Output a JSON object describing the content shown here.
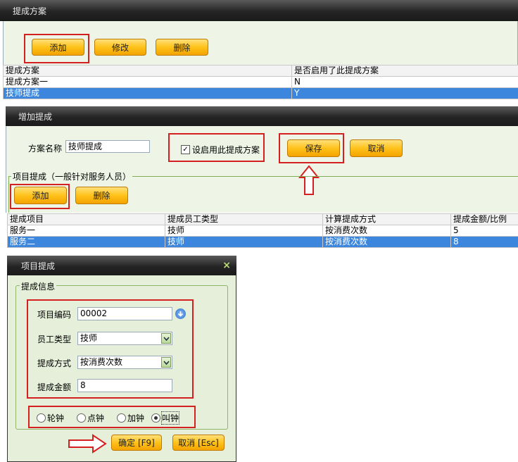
{
  "scheme_panel": {
    "title": "提成方案",
    "buttons": {
      "add": "添加",
      "edit": "修改",
      "delete": "删除"
    },
    "table": {
      "headers": [
        "提成方案",
        "是否启用了此提成方案"
      ],
      "rows": [
        {
          "name": "提成方案一",
          "enabled": "N"
        },
        {
          "name": "技师提成",
          "enabled": "Y"
        }
      ]
    }
  },
  "add_panel": {
    "title": "增加提成",
    "name_label": "方案名称",
    "name_value": "技师提成",
    "enable_checkbox_label": "设启用此提成方案",
    "enable_checked": true,
    "save_label": "保存",
    "cancel_label": "取消",
    "group_title": "项目提成（一般针对服务人员）",
    "add_label": "添加",
    "delete_label": "删除",
    "table": {
      "headers": [
        "提成项目",
        "提成员工类型",
        "计算提成方式",
        "提成金额/比例"
      ],
      "rows": [
        {
          "item": "服务一",
          "type": "技师",
          "method": "按消费次数",
          "amount": "5"
        },
        {
          "item": "服务二",
          "type": "技师",
          "method": "按消费次数",
          "amount": "8"
        }
      ]
    }
  },
  "dialog": {
    "title": "项目提成",
    "close": "×",
    "group_title": "提成信息",
    "code_label": "项目编码",
    "code_value": "00002",
    "type_label": "员工类型",
    "type_value": "技师",
    "method_label": "提成方式",
    "method_value": "按消费次数",
    "amount_label": "提成金额",
    "amount_value": "8",
    "radios": [
      {
        "label": "轮钟",
        "checked": false
      },
      {
        "label": "点钟",
        "checked": false
      },
      {
        "label": "加钟",
        "checked": false
      },
      {
        "label": "叫钟",
        "checked": true
      }
    ],
    "ok_label": "确定 [F9]",
    "cancel_label": "取消 [Esc]"
  },
  "colors": {
    "highlight": "#d42020",
    "selected_row": "#3c86dd",
    "button": "#ffc21a",
    "panel": "#eef5e6"
  }
}
